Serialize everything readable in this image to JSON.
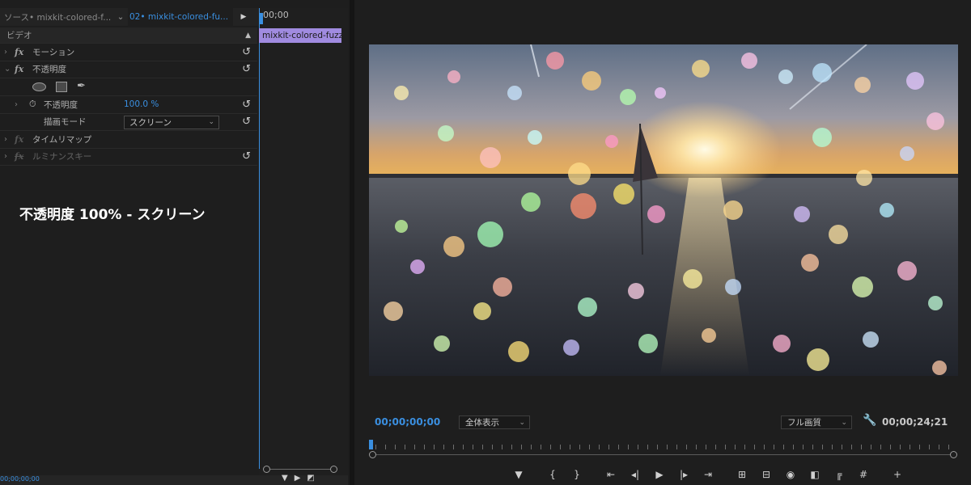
{
  "effect_controls": {
    "tabs": {
      "source": "ソース• mixkit-colored-f...",
      "sequence": "02• mixkit-colored-fu...",
      "chevron_icon": "chevron-down-icon",
      "play_icon": "play-icon"
    },
    "section": "ビデオ",
    "motion": "モーション",
    "opacity": "不透明度",
    "opacity_param": "不透明度",
    "opacity_value": "100.0 %",
    "blend_mode_label": "描画モード",
    "blend_mode_value": "スクリーン",
    "time_remap": "タイムリマップ",
    "luma_key": "ルミナンスキー",
    "fx_label": "fx",
    "caption": "不透明度 100% - スクリーン"
  },
  "mini_timeline": {
    "time": "00;00",
    "clip": "mixkit-colored-fuzz",
    "bottom_time": "00;00;00;00"
  },
  "program_monitor": {
    "current_time": "00;00;00;00",
    "fit": "全体表示",
    "quality": "フル画質",
    "duration": "00;00;24;21",
    "transport_icons": [
      "marker-icon",
      "mark-in-icon",
      "mark-out-icon",
      "go-to-in-icon",
      "step-back-icon",
      "play-icon",
      "step-forward-icon",
      "go-to-out-icon",
      "insert-icon",
      "overwrite-icon",
      "export-frame-icon",
      "comparison-icon",
      "trim-icon",
      "safe-margins-icon",
      "add-button-icon"
    ]
  },
  "colors": {
    "accent": "#3a8fe0",
    "clip": "#a08be0"
  }
}
